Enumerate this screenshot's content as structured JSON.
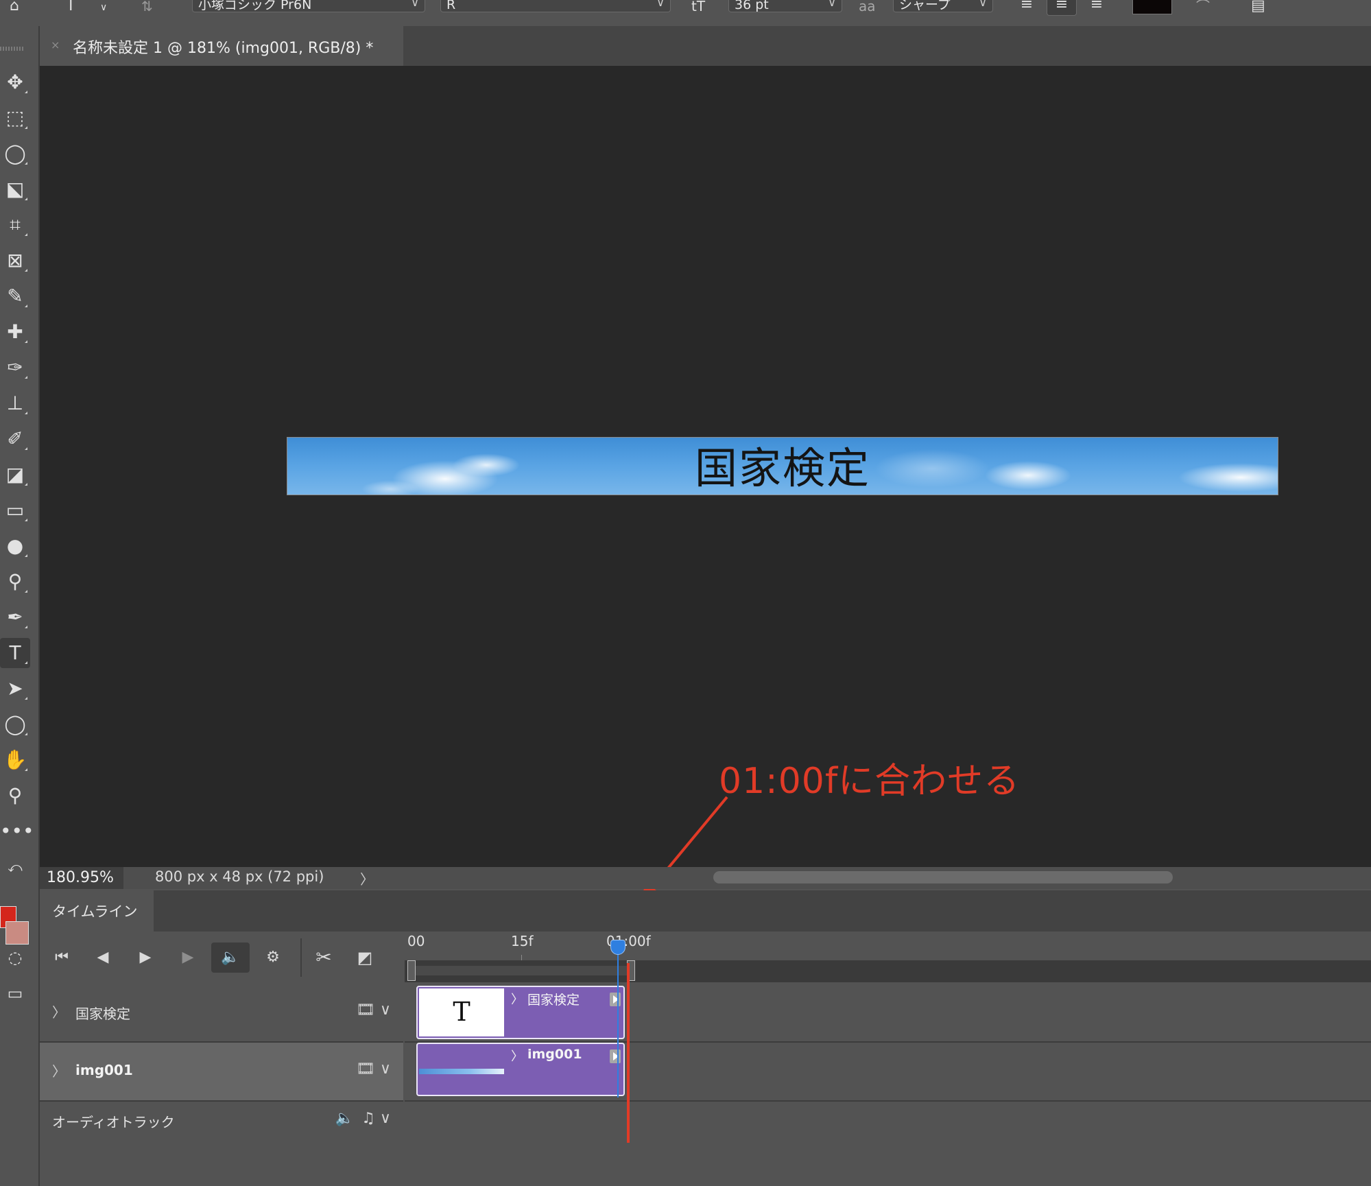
{
  "options_bar": {
    "tool_icon": "type-tool-icon",
    "font_family": "小塚ゴシック Pr6N",
    "font_style": "R",
    "font_size": "36 pt",
    "anti_alias": "シャープ",
    "text_color": "#0b0606",
    "icon_size": "tT",
    "icon_aa": "aa"
  },
  "document": {
    "tab_title": "名称未設定 1 @ 181% (img001, RGB/8) *",
    "close_glyph": "×"
  },
  "canvas": {
    "banner_text": "国家検定",
    "annotation": "01:00fに合わせる",
    "annotation_color": "#e13b27"
  },
  "status": {
    "zoom": "180.95%",
    "doc_size": "800 px x 48 px (72 ppi)",
    "chevron": "〉"
  },
  "colors": {
    "foreground": "#d4261c",
    "background": "#c98b82",
    "clip": "#7c5eb3",
    "playhead": "#e13b27"
  },
  "timeline": {
    "panel_title": "タイムライン",
    "ruler": [
      "00",
      "15f",
      "01:00f"
    ],
    "tracks": [
      {
        "name": "国家検定",
        "clip_label": "国家検定",
        "thumb": "T"
      },
      {
        "name": "img001",
        "clip_label": "img001"
      }
    ],
    "audio_track": "オーディオトラック",
    "chevron": "〉"
  }
}
